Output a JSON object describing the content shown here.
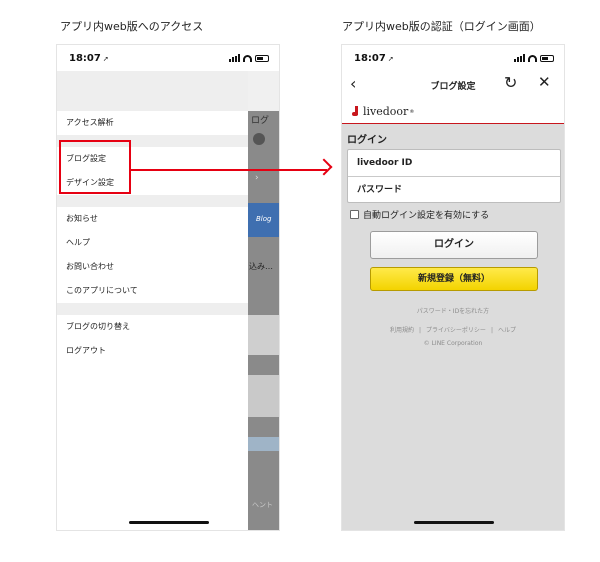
{
  "captions": {
    "left": "アプリ内web版へのアクセス",
    "right": "アプリ内web版の認証（ログイン画面）"
  },
  "status_bar": {
    "time": "18:07",
    "location_glyph": "➚"
  },
  "left_phone": {
    "menu_groups": [
      [
        "アクセス解析"
      ],
      [
        "ブログ設定",
        "デザイン設定"
      ],
      [
        "お知らせ",
        "ヘルプ",
        "お問い合わせ",
        "このアプリについて"
      ],
      [
        "ブログの切り替え",
        "ログアウト"
      ]
    ],
    "background_peek": {
      "blog_text": "ログ",
      "image_text": "Blog",
      "snippet": "込み…",
      "footer_text": "ヘント"
    },
    "highlight_color": "#e60012"
  },
  "right_phone": {
    "nav": {
      "title": "ブログ設定",
      "back_icon": "‹",
      "reload_icon": "↻",
      "close_icon": "✕"
    },
    "brand": {
      "logo_text": "livedoor",
      "accent": "#c8161d"
    },
    "section_title": "ログイン",
    "fields": {
      "id_placeholder": "livedoor ID",
      "password_placeholder": "パスワード"
    },
    "auto_login_label": "自動ログイン設定を有効にする",
    "auto_login_checked": false,
    "login_button": "ログイン",
    "register_button": "新規登録（無料）",
    "forgot_link": "パスワード・IDを忘れた方",
    "footer_links": [
      "利用規約",
      "プライバシーポリシー",
      "ヘルプ"
    ],
    "copyright": "© LINE Corporation"
  }
}
